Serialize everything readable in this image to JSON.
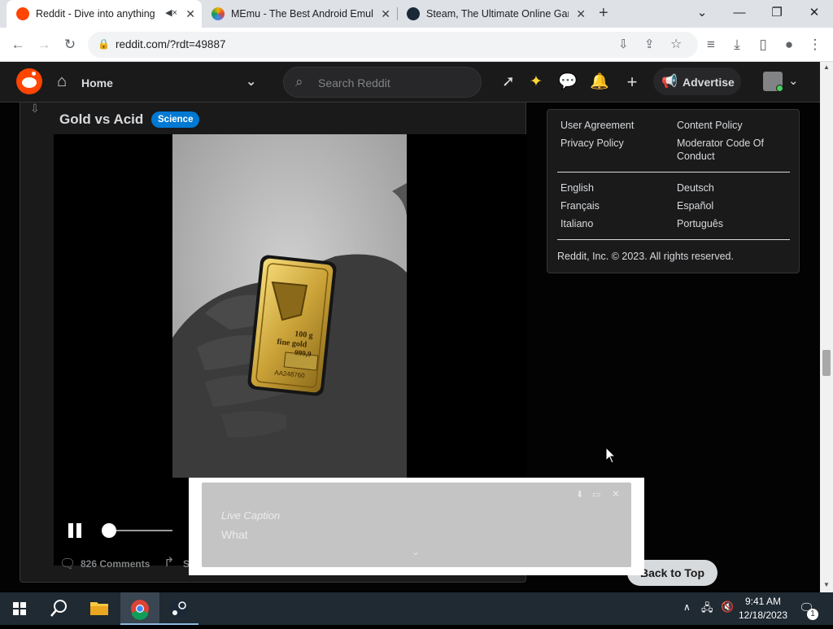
{
  "browser": {
    "tabs": [
      {
        "title": "Reddit - Dive into anything",
        "favicon_color": "#ff4500",
        "muted_icon": "speaker-muted-icon",
        "active": true
      },
      {
        "title": "MEmu - The Best Android Emulator",
        "favicon_color": "#7e57c2",
        "active": false
      },
      {
        "title": "Steam, The Ultimate Online Game Platform",
        "favicon_color": "#1b2838",
        "active": false
      }
    ],
    "new_tab_icon": "+",
    "address": "reddit.com/?rdt=49887"
  },
  "reddit": {
    "nav": {
      "home_label": "Home",
      "search_placeholder": "Search Reddit",
      "advertise_label": "Advertise"
    },
    "post": {
      "title": "Gold vs Acid",
      "flair": "Science",
      "flair_color": "#0079d3",
      "comments_label": "826 Comments",
      "share_label": "S",
      "bar_text": [
        "100 g",
        "fine gold",
        "999,9",
        "AA248760"
      ]
    },
    "sidebar": {
      "links_left": [
        "User Agreement",
        "Privacy Policy"
      ],
      "links_right": [
        "Content Policy",
        "Moderator Code Of Conduct"
      ],
      "languages_left": [
        "English",
        "Français",
        "Italiano"
      ],
      "languages_right": [
        "Deutsch",
        "Español",
        "Português"
      ],
      "copyright": "Reddit, Inc. © 2023. All rights reserved."
    },
    "back_to_top": "Back to Top"
  },
  "live_caption": {
    "title": "Live Caption",
    "text": "What"
  },
  "taskbar": {
    "time": "9:41 AM",
    "date": "12/18/2023",
    "notification_count": "1"
  }
}
